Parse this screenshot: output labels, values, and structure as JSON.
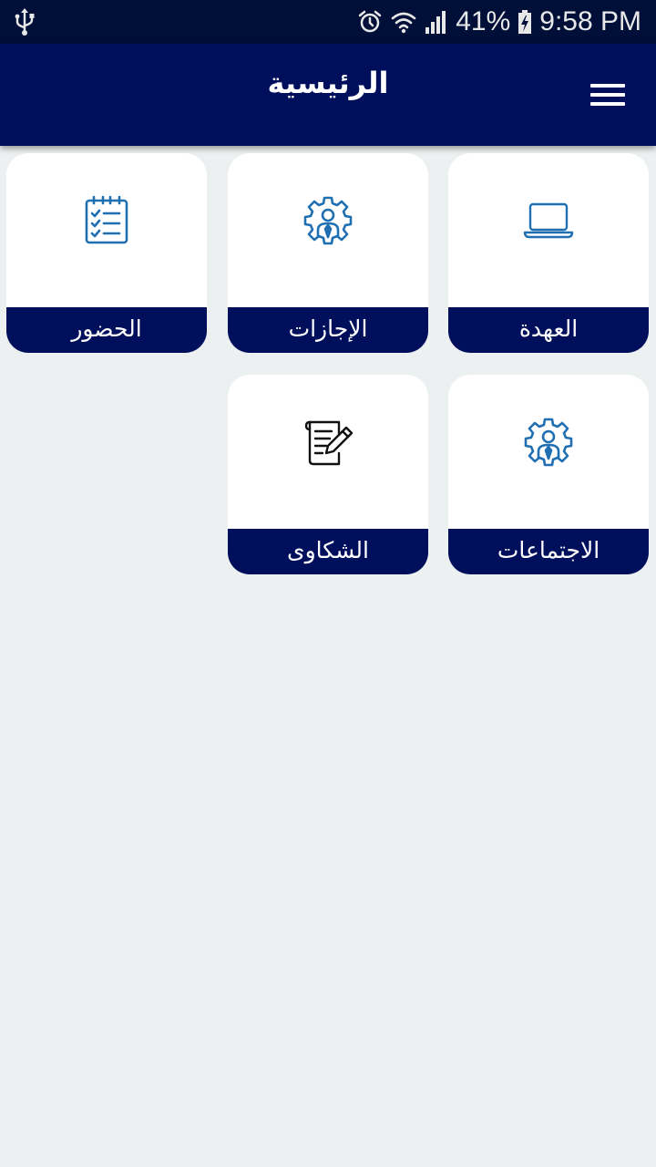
{
  "status_bar": {
    "battery": "41%",
    "time": "9:58 PM",
    "icons": [
      "usb-icon",
      "alarm-icon",
      "wifi-icon",
      "signal-icon",
      "battery-icon"
    ]
  },
  "header": {
    "title": "الرئيسية",
    "menu_icon": "hamburger-menu-icon"
  },
  "tiles": [
    {
      "label": "العهدة",
      "icon": "laptop-icon"
    },
    {
      "label": "الإجازات",
      "icon": "employee-gear-icon"
    },
    {
      "label": "الحضور",
      "icon": "checklist-calendar-icon"
    },
    {
      "label": "الاجتماعات",
      "icon": "employee-gear-icon"
    },
    {
      "label": "الشكاوى",
      "icon": "note-pencil-icon"
    }
  ],
  "colors": {
    "primary": "#000f5c",
    "status_bar": "#000f38",
    "icon_blue": "#1f6fb2",
    "background": "#ecf0f0",
    "tile": "#ffffff"
  }
}
